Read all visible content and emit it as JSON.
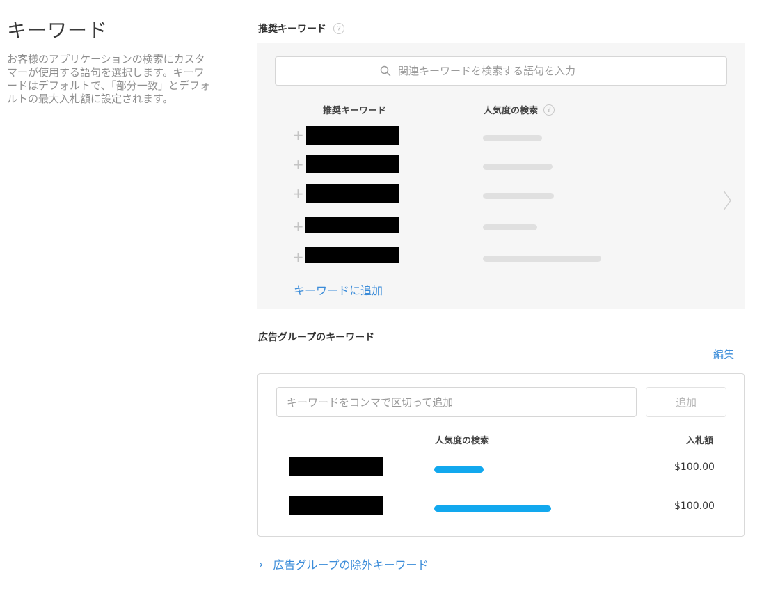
{
  "intro": {
    "title": "キーワード",
    "description": "お客様のアプリケーションの検索にカスタマーが使用する語句を選択します。キーワードはデフォルトで、「部分一致」とデフォルトの最大入札額に設定されます。"
  },
  "recommended": {
    "section_title": "推奨キーワード",
    "help_glyph": "?",
    "search_placeholder": "関連キーワードを検索する語句を入力",
    "col_keyword": "推奨キーワード",
    "col_popularity": "人気度の検索",
    "rows": [
      {
        "plus": "+",
        "redacted": true,
        "popularity": 0.5
      },
      {
        "plus": "+",
        "redacted": true,
        "popularity": 0.59
      },
      {
        "plus": "+",
        "redacted": true,
        "popularity": 0.6
      },
      {
        "plus": "+",
        "redacted": true,
        "popularity": 0.46
      },
      {
        "plus": "+",
        "redacted": true,
        "popularity": 1.0
      }
    ],
    "add_link": "キーワードに追加"
  },
  "ad_group": {
    "section_title": "広告グループのキーワード",
    "edit_label": "編集",
    "input_placeholder": "キーワードをコンマで区切って追加",
    "add_button": "追加",
    "col_popularity": "人気度の検索",
    "col_bid": "入札額",
    "rows": [
      {
        "redacted": true,
        "popularity": 0.42,
        "bid": "$100.00"
      },
      {
        "redacted": true,
        "popularity": 1.0,
        "bid": "$100.00"
      }
    ]
  },
  "negative_link": {
    "chevron": "›",
    "label": "広告グループの除外キーワード"
  },
  "colors": {
    "accent": "#3b8cd9",
    "popularity_active": "#12a8ee",
    "popularity_muted": "#e0e0e0",
    "panel_bg": "#f6f6f6"
  },
  "icons": [
    "search-icon",
    "help-icon",
    "plus-icon",
    "chevron-right-icon"
  ]
}
